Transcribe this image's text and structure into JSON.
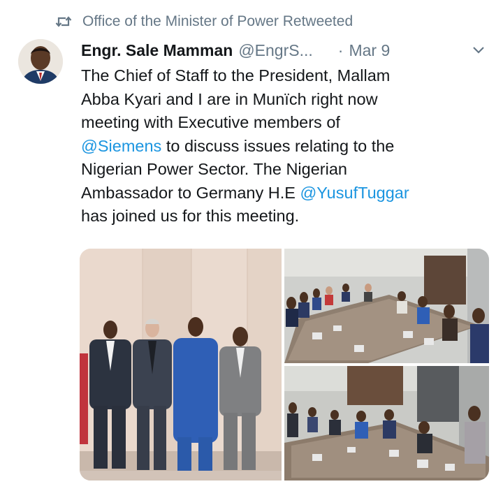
{
  "retweet": {
    "icon": "retweet-icon",
    "text": "Office of the Minister of Power Retweeted"
  },
  "tweet": {
    "author": {
      "name": "Engr. Sale Mamman",
      "handle": "@EngrS...",
      "avatar_icon": "avatar"
    },
    "separator": "·",
    "date": "Mar 9",
    "menu_icon": "chevron-down-icon",
    "lines": [
      [
        "The Chief of Staff to the President, Mallam"
      ],
      [
        "Abba Kyari and I are in Munïch right now"
      ],
      [
        "meeting with Executive members of"
      ],
      [
        "@Siemens",
        " to discuss issues relating to the"
      ],
      [
        "Nigerian Power Sector. The Nigerian"
      ],
      [
        "Ambassador to Germany H.E ",
        "@YusufTuggar"
      ],
      [
        "has joined us for this meeting."
      ]
    ],
    "photos": [
      "group-standing-photo",
      "meeting-table-photo-top",
      "meeting-table-photo-bottom"
    ]
  },
  "colors": {
    "link": "#1b95e0",
    "secondary": "#657786",
    "text": "#14171a"
  }
}
